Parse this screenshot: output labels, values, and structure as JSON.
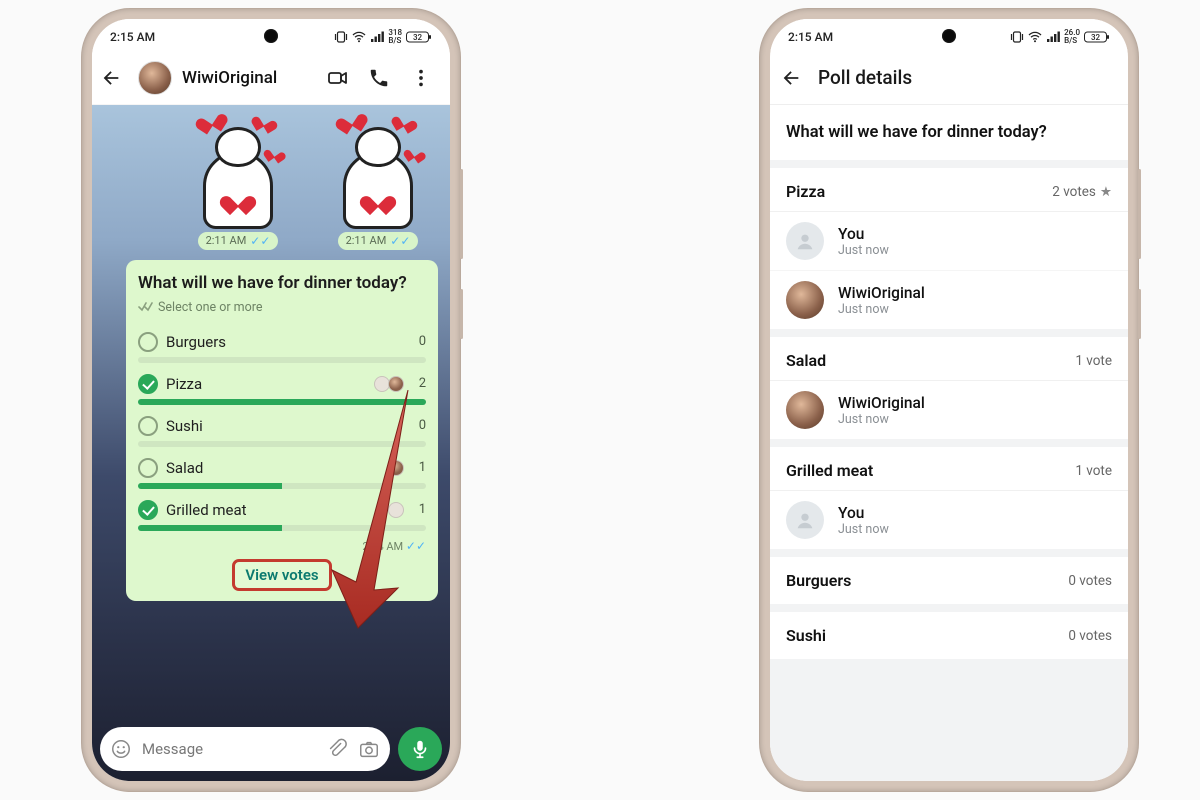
{
  "status": {
    "time": "2:15 AM",
    "speed_left": "318",
    "battery_left": "32",
    "speed_right": "26.0",
    "battery_right": "32"
  },
  "chat": {
    "name": "WiwiOriginal",
    "sticker_time": "2:11 AM",
    "poll": {
      "question": "What will we have for dinner today?",
      "hint": "Select one or more",
      "options": [
        {
          "label": "Burguers",
          "count": 0,
          "checked": false,
          "fill": 0
        },
        {
          "label": "Pizza",
          "count": 2,
          "checked": true,
          "fill": 100
        },
        {
          "label": "Sushi",
          "count": 0,
          "checked": false,
          "fill": 0
        },
        {
          "label": "Salad",
          "count": 1,
          "checked": false,
          "fill": 50
        },
        {
          "label": "Grilled meat",
          "count": 1,
          "checked": true,
          "fill": 50
        }
      ],
      "time": "2:14 AM",
      "view_votes": "View votes"
    },
    "input_placeholder": "Message"
  },
  "poll_details": {
    "title": "Poll details",
    "question": "What will we have for dinner today?",
    "options": [
      {
        "name": "Pizza",
        "votes_label": "2 votes",
        "starred": true,
        "voters": [
          {
            "name": "You",
            "when": "Just now",
            "photo": false
          },
          {
            "name": "WiwiOriginal",
            "when": "Just now",
            "photo": true
          }
        ]
      },
      {
        "name": "Salad",
        "votes_label": "1 vote",
        "starred": false,
        "voters": [
          {
            "name": "WiwiOriginal",
            "when": "Just now",
            "photo": true
          }
        ]
      },
      {
        "name": "Grilled meat",
        "votes_label": "1 vote",
        "starred": false,
        "voters": [
          {
            "name": "You",
            "when": "Just now",
            "photo": false
          }
        ]
      },
      {
        "name": "Burguers",
        "votes_label": "0 votes",
        "starred": false,
        "voters": []
      },
      {
        "name": "Sushi",
        "votes_label": "0 votes",
        "starred": false,
        "voters": []
      }
    ]
  }
}
